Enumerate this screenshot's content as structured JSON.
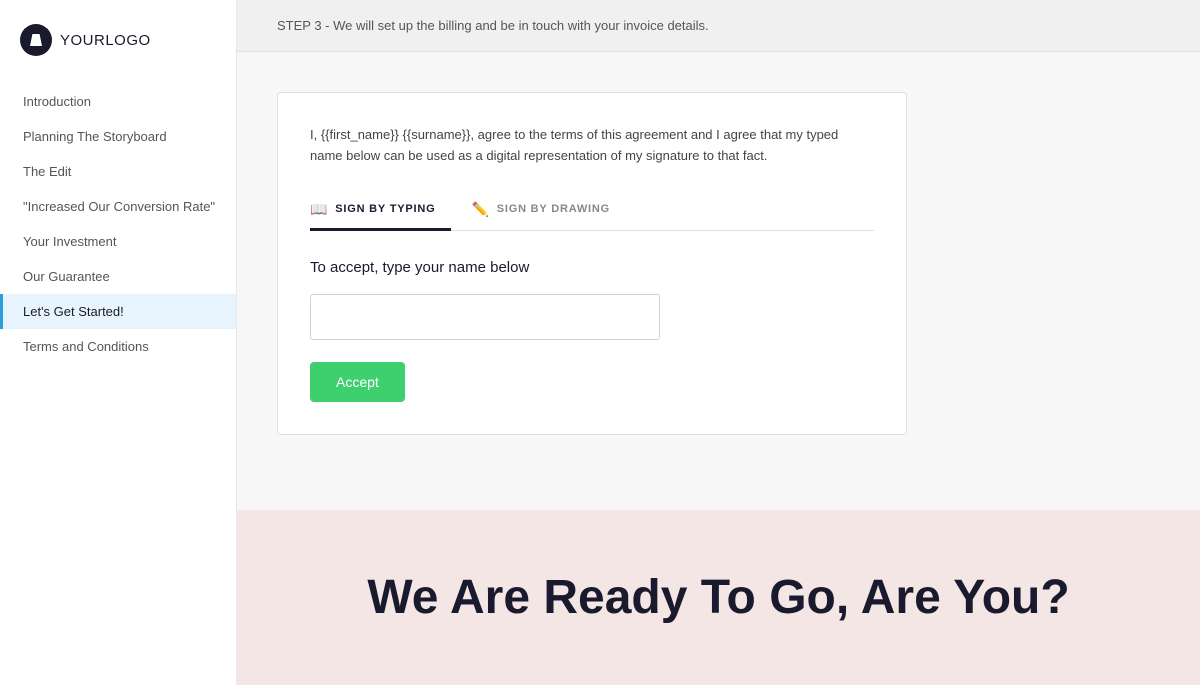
{
  "logo": {
    "text_bold": "YOUR",
    "text_light": "LOGO"
  },
  "sidebar": {
    "items": [
      {
        "id": "introduction",
        "label": "Introduction",
        "active": false
      },
      {
        "id": "planning-storyboard",
        "label": "Planning The Storyboard",
        "active": false
      },
      {
        "id": "the-edit",
        "label": "The Edit",
        "active": false
      },
      {
        "id": "increased-conversion",
        "label": "\"Increased Our Conversion Rate\"",
        "active": false
      },
      {
        "id": "your-investment",
        "label": "Your Investment",
        "active": false
      },
      {
        "id": "our-guarantee",
        "label": "Our Guarantee",
        "active": false
      },
      {
        "id": "lets-get-started",
        "label": "Let's Get Started!",
        "active": true
      },
      {
        "id": "terms-conditions",
        "label": "Terms and Conditions",
        "active": false
      }
    ]
  },
  "top_banner": {
    "text": "STEP 3 - We will set up the billing and be in touch with your invoice details."
  },
  "signature_card": {
    "agreement_text": "I, {{first_name}} {{surname}}, agree to the terms of this agreement and I agree that my typed name below can be used as a digital representation of my signature to that fact.",
    "tabs": [
      {
        "id": "sign-by-typing",
        "label": "SIGN BY TYPING",
        "icon": "📖",
        "active": true
      },
      {
        "id": "sign-by-drawing",
        "label": "SIGN BY DRAWING",
        "icon": "✏️",
        "active": false
      }
    ],
    "type_prompt": "To accept, type your name below",
    "input_placeholder": "",
    "accept_button": "Accept"
  },
  "cta": {
    "text": "We Are Ready To Go, Are You?"
  }
}
